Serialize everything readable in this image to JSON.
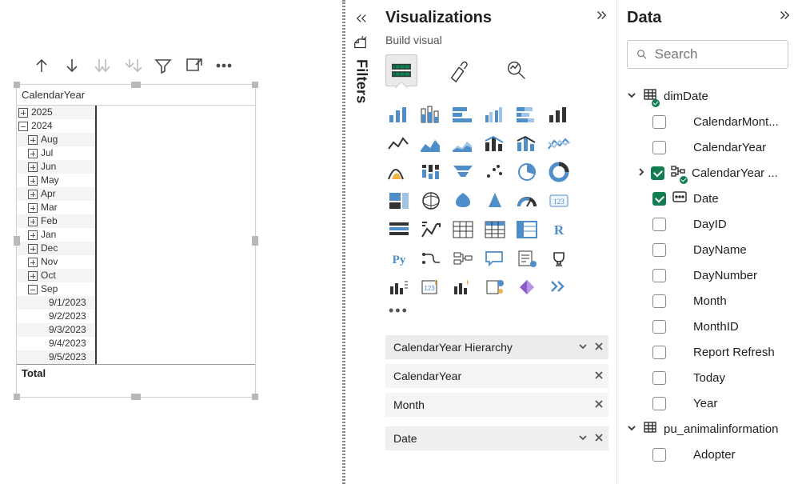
{
  "matrix": {
    "header": "CalendarYear",
    "years": [
      {
        "label": "2025",
        "expanded": false
      },
      {
        "label": "2024",
        "expanded": true
      }
    ],
    "months": [
      "Aug",
      "Jul",
      "Jun",
      "May",
      "Apr",
      "Mar",
      "Feb",
      "Jan",
      "Dec",
      "Nov",
      "Oct",
      "Sep"
    ],
    "sep_dates": [
      "9/1/2023",
      "9/2/2023",
      "9/3/2023",
      "9/4/2023",
      "9/5/2023"
    ],
    "total_label": "Total"
  },
  "filters_label": "Filters",
  "viz": {
    "title": "Visualizations",
    "subtitle": "Build visual",
    "wells": [
      {
        "label": "CalendarYear Hierarchy",
        "chevron": true,
        "close": true
      },
      {
        "label": "CalendarYear",
        "chevron": false,
        "close": true
      },
      {
        "label": "Month",
        "chevron": false,
        "close": true
      },
      {
        "label": "Date",
        "chevron": true,
        "close": true
      }
    ]
  },
  "data": {
    "title": "Data",
    "search_placeholder": "Search",
    "tables": [
      {
        "name": "dimDate",
        "hasCheck": true,
        "fields": [
          {
            "name": "CalendarMont...",
            "checked": false
          },
          {
            "name": "CalendarYear",
            "checked": false
          },
          {
            "name": "CalendarYear ...",
            "checked": true,
            "hasChevron": true,
            "hierarchy": true
          },
          {
            "name": "Date",
            "checked": true,
            "dateIcon": true
          },
          {
            "name": "DayID",
            "checked": false
          },
          {
            "name": "DayName",
            "checked": false
          },
          {
            "name": "DayNumber",
            "checked": false
          },
          {
            "name": "Month",
            "checked": false
          },
          {
            "name": "MonthID",
            "checked": false
          },
          {
            "name": "Report Refresh",
            "checked": false
          },
          {
            "name": "Today",
            "checked": false
          },
          {
            "name": "Year",
            "checked": false
          }
        ]
      },
      {
        "name": "pu_animalinformation",
        "hasCheck": false,
        "fields": [
          {
            "name": "Adopter",
            "checked": false
          }
        ]
      }
    ]
  }
}
